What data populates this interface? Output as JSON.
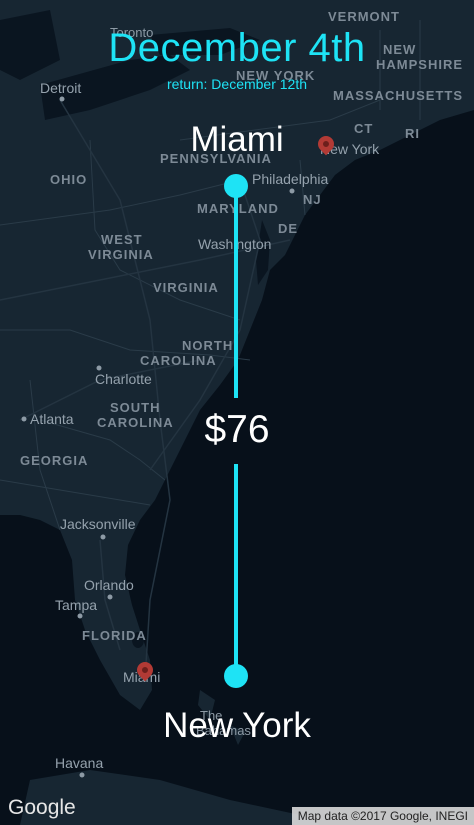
{
  "header": {
    "date": "December 4th",
    "return_text": "return: December 12th"
  },
  "route": {
    "origin": "Miami",
    "destination": "New York",
    "price": "$76"
  },
  "colors": {
    "accent": "#1ee3f5",
    "map_bg": "#0b1620",
    "pin": "#b23a35"
  },
  "map": {
    "labels": {
      "toronto": "Toronto",
      "vermont": "VERMONT",
      "new_hampshire_1": "NEW",
      "new_hampshire_2": "HAMPSHIRE",
      "new_york_state": "NEW YORK",
      "detroit": "Detroit",
      "massachusetts": "MASSACHUSETTS",
      "ct": "CT",
      "ri": "RI",
      "pennsylvania": "PENNSYLVANIA",
      "new_york_city": "New York",
      "ohio": "OHIO",
      "philadelphia": "Philadelphia",
      "nj": "NJ",
      "maryland": "MARYLAND",
      "de": "DE",
      "washington": "Washington",
      "west_virginia_1": "WEST",
      "west_virginia_2": "VIRGINIA",
      "virginia": "VIRGINIA",
      "north_carolina_1": "NORTH",
      "north_carolina_2": "CAROLINA",
      "charlotte": "Charlotte",
      "south_carolina_1": "SOUTH",
      "south_carolina_2": "CAROLINA",
      "atlanta": "Atlanta",
      "georgia": "GEORGIA",
      "jacksonville": "Jacksonville",
      "orlando": "Orlando",
      "tampa": "Tampa",
      "florida": "FLORIDA",
      "miami": "Miami",
      "the_bahamas_1": "The",
      "the_bahamas_2": "Bahamas",
      "havana": "Havana"
    },
    "logo": "Google",
    "credit": "Map data ©2017 Google, INEGI"
  }
}
